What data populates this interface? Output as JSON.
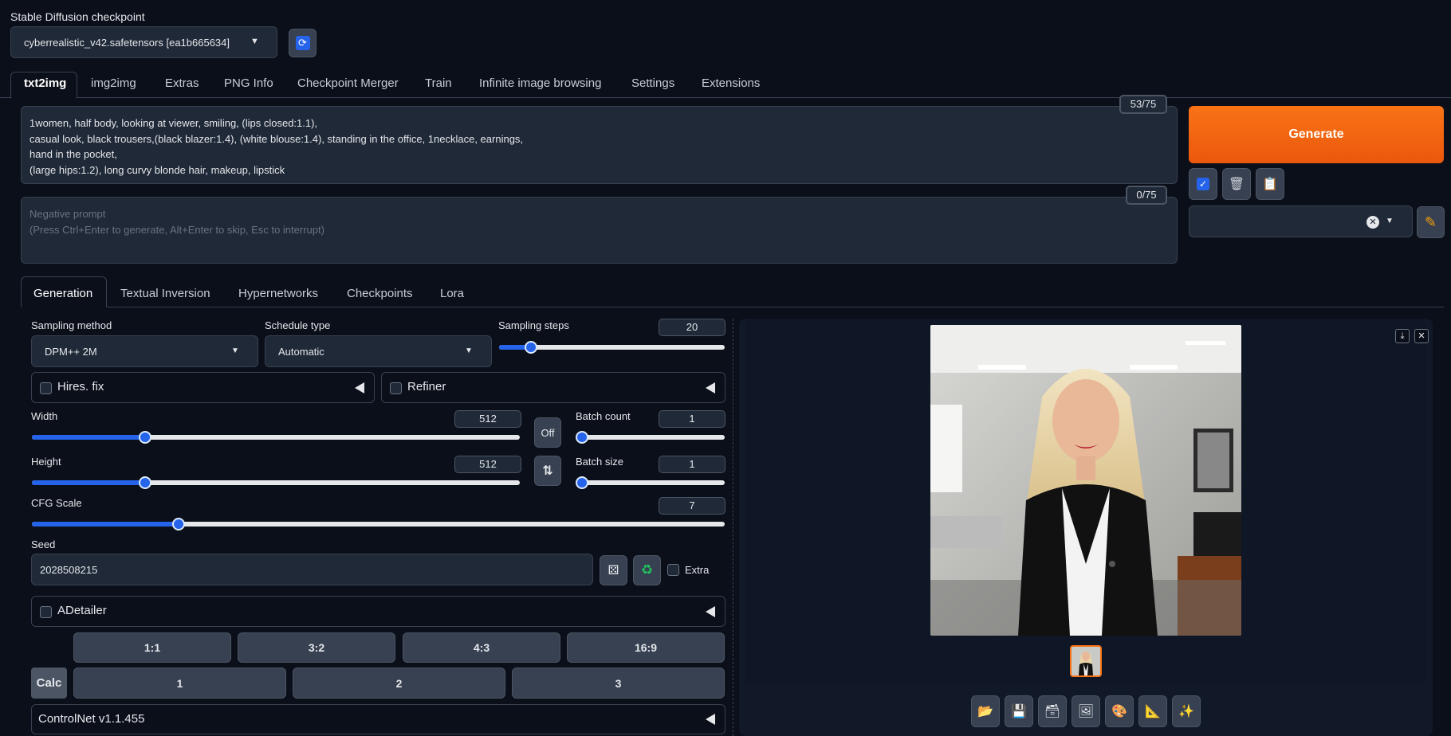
{
  "checkpoint": {
    "label": "Stable Diffusion checkpoint",
    "value": "cyberrealistic_v42.safetensors [ea1b665634]",
    "refresh_icon": "refresh-icon"
  },
  "main_tabs": [
    "txt2img",
    "img2img",
    "Extras",
    "PNG Info",
    "Checkpoint Merger",
    "Train",
    "Infinite image browsing",
    "Settings",
    "Extensions"
  ],
  "prompt": {
    "counter": "53/75",
    "lines": [
      "1women, half body, looking at viewer, smiling, (lips closed:1.1),",
      "casual look, black trousers,(black blazer:1.4), (white blouse:1.4), standing in the office, 1necklace, earnings,",
      "hand in the pocket,",
      "(large hips:1.2), long curvy blonde hair, makeup, lipstick"
    ]
  },
  "negative_prompt": {
    "counter": "0/75",
    "placeholder_line1": "Negative prompt",
    "placeholder_line2": "(Press Ctrl+Enter to generate, Alt+Enter to skip, Esc to interrupt)"
  },
  "generate": {
    "label": "Generate",
    "color": "#ea580c"
  },
  "sub_tabs": [
    "Generation",
    "Textual Inversion",
    "Hypernetworks",
    "Checkpoints",
    "Lora"
  ],
  "sampling": {
    "method_label": "Sampling method",
    "method_value": "DPM++ 2M",
    "schedule_label": "Schedule type",
    "schedule_value": "Automatic",
    "steps_label": "Sampling steps",
    "steps_value": "20"
  },
  "hires": {
    "label": "Hires. fix"
  },
  "refiner": {
    "label": "Refiner"
  },
  "width": {
    "label": "Width",
    "value": "512"
  },
  "height": {
    "label": "Height",
    "value": "512"
  },
  "off_button": "Off",
  "batch_count": {
    "label": "Batch count",
    "value": "1"
  },
  "batch_size": {
    "label": "Batch size",
    "value": "1"
  },
  "cfg": {
    "label": "CFG Scale",
    "value": "7"
  },
  "seed": {
    "label": "Seed",
    "value": "2028508215",
    "extra_label": "Extra"
  },
  "adetailer": {
    "label": "ADetailer"
  },
  "ratios": [
    "1:1",
    "3:2",
    "4:3",
    "16:9"
  ],
  "calc": {
    "label": "Calc",
    "buttons": [
      "1",
      "2",
      "3"
    ]
  },
  "controlnet": {
    "label": "ControlNet v1.1.455"
  },
  "accent_color": "#2563eb"
}
